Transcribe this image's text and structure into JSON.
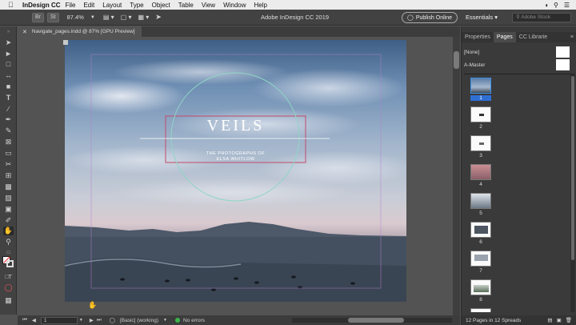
{
  "menubar": {
    "app": "InDesign CC",
    "items": [
      "File",
      "Edit",
      "Layout",
      "Type",
      "Object",
      "Table",
      "View",
      "Window",
      "Help"
    ]
  },
  "appbar": {
    "br": "Br",
    "st": "St",
    "zoom": "87.4%",
    "title": "Adobe InDesign CC 2019",
    "publish": "Publish Online",
    "workspace": "Essentials",
    "search_placeholder": "Adobe Stock"
  },
  "document": {
    "tab": "Navigate_pages.indd @ 87% [GPU Preview]"
  },
  "artwork": {
    "title": "VEILS",
    "subtitle_1": "THE PHOTOGRAPHS OF",
    "subtitle_2": "ELSA WHITLOW"
  },
  "panel": {
    "tabs": [
      "Properties",
      "Pages",
      "CC Librarie"
    ],
    "masters": [
      "[None]",
      "A-Master"
    ],
    "page_numbers": [
      "1",
      "2",
      "3",
      "4",
      "5",
      "6",
      "7",
      "8"
    ],
    "footer": "12 Pages in 12 Spreads"
  },
  "status": {
    "page": "1",
    "style": "[Basic] (working)",
    "errors": "No errors"
  }
}
